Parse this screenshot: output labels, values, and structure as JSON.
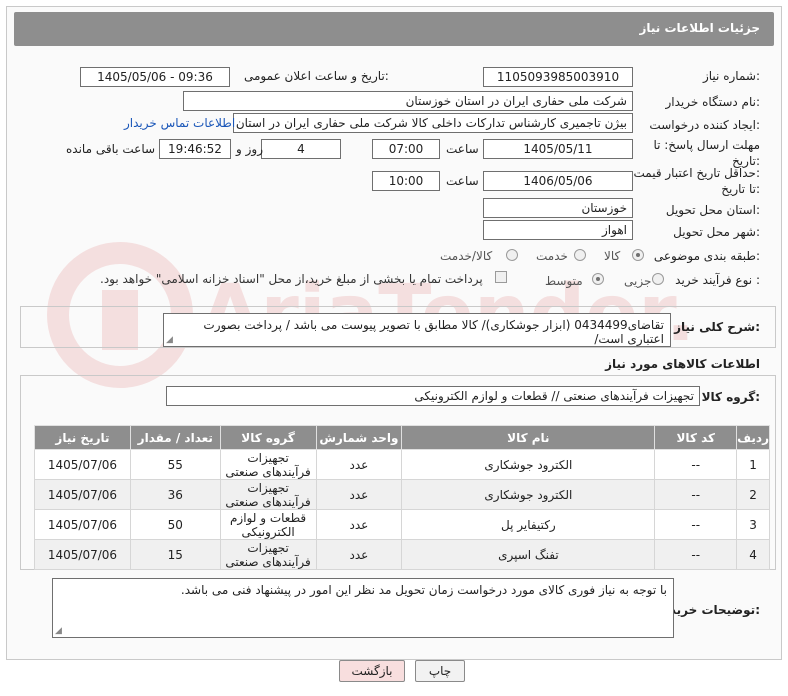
{
  "header": {
    "title": "جزئیات اطلاعات نیاز"
  },
  "fields": {
    "need_number_label": "شماره نیاز:",
    "need_number": "1105093985003910",
    "announce_label": "تاریخ و ساعت اعلان عمومی:",
    "announce_value": "1405/05/06 - 09:36",
    "buyer_label": "نام دستگاه خریدار:",
    "buyer_value": "شرکت ملی حفاری ایران در استان خوزستان",
    "creator_label": "ایجاد کننده درخواست:",
    "creator_value": "بیژن تاجمیری کارشناس تدارکات داخلی کالا شرکت ملی حفاری ایران در استان خوزستان",
    "contact_link": "اطلاعات تماس خریدار",
    "reply_label_1": "مهلت ارسال پاسخ: تا",
    "reply_label_2": "تاریخ:",
    "reply_date": "1405/05/11",
    "time_label": "ساعت",
    "reply_time": "07:00",
    "days_value": "4",
    "days_label": "روز و",
    "remaining_time": "19:46:52",
    "remaining_label": "ساعت باقی مانده",
    "price_label_1": "حداقل تاریخ اعتبار قیمت:",
    "price_label_2": "تا تاریخ:",
    "price_date": "1406/05/06",
    "price_time_label": "ساعت",
    "price_time": "10:00",
    "province_label": "استان محل تحویل:",
    "province_value": "خوزستان",
    "city_label": "شهر محل تحویل:",
    "city_value": "اهواز",
    "category_label": "طبقه بندی موضوعی:",
    "category_options": [
      "کالا",
      "خدمت",
      "کالا/خدمت"
    ],
    "process_label": "نوع فرآیند خرید :",
    "process_options": [
      "جزیی",
      "متوسط"
    ],
    "payment_note": "پرداخت تمام یا بخشی از مبلغ خرید،از محل \"اسناد خزانه اسلامی\" خواهد بود."
  },
  "description": {
    "label": "شرح کلی نیاز:",
    "value": "تقاضای0434499 (ابزار جوشکاری)/ کالا مطابق با تصویر پیوست می باشد / پرداخت بصورت اعتباری است/"
  },
  "goods": {
    "section_title": "اطلاعات کالاهای مورد نیاز",
    "group_label": "گروه کالا:",
    "group_value": "تجهیزات فرآیندهای صنعتی // قطعات و لوازم الکترونیکی",
    "columns": [
      "ردیف",
      "کد کالا",
      "نام کالا",
      "واحد شمارش",
      "گروه کالا",
      "تعداد / مقدار",
      "تاریخ نیاز"
    ],
    "rows": [
      {
        "row": "1",
        "code": "--",
        "name": "الکترود جوشکاری",
        "unit": "عدد",
        "group": "تجهیزات فرآیندهای صنعتی",
        "qty": "55",
        "date": "1405/07/06"
      },
      {
        "row": "2",
        "code": "--",
        "name": "الکترود جوشکاری",
        "unit": "عدد",
        "group": "تجهیزات فرآیندهای صنعتی",
        "qty": "36",
        "date": "1405/07/06"
      },
      {
        "row": "3",
        "code": "--",
        "name": "رکتیفایر پل",
        "unit": "عدد",
        "group": "قطعات و لوازم الکترونیکی",
        "qty": "50",
        "date": "1405/07/06"
      },
      {
        "row": "4",
        "code": "--",
        "name": "تفنگ اسپری",
        "unit": "عدد",
        "group": "تجهیزات فرآیندهای صنعتی",
        "qty": "15",
        "date": "1405/07/06"
      }
    ]
  },
  "buyer_notes": {
    "label": "توضیحات خریدار:",
    "value": "با توجه به نیاز فوری کالای مورد درخواست زمان تحویل  مد نظر این امور در پیشنهاد فنی می باشد."
  },
  "buttons": {
    "print": "چاپ",
    "back": "بازگشت"
  },
  "watermark": {
    "text": "AriaTender.net"
  },
  "colors": {
    "header_bg": "#8e8e8e",
    "link": "#1a56b8",
    "back_button_bg": "#f8dede",
    "watermark": "#d32f2f"
  }
}
